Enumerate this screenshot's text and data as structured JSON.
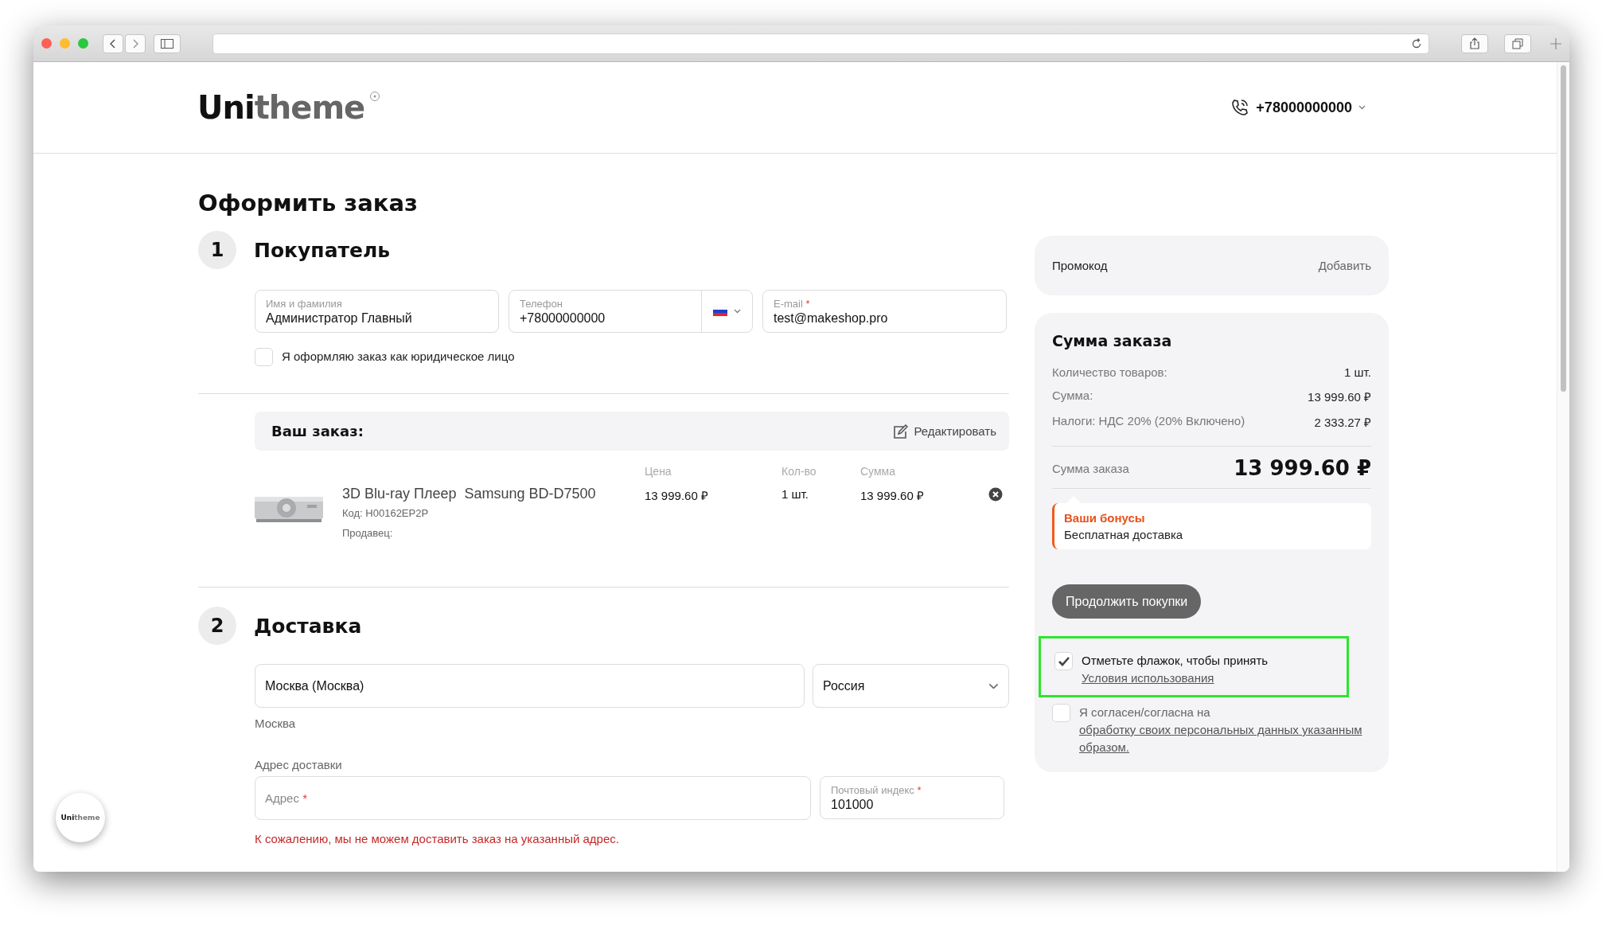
{
  "header": {
    "logo": {
      "primary": "Uni",
      "secondary": "theme"
    },
    "phone": "+78000000000"
  },
  "title": "Оформить заказ",
  "buyer": {
    "step": "1",
    "heading": "Покупатель",
    "fields": [
      {
        "label": "Имя и фамилия",
        "value": "Администратор Главный"
      },
      {
        "label": "Телефон",
        "value": "+78000000000"
      },
      {
        "label": "E-mail",
        "required_mark": "*",
        "value": "test@makeshop.pro"
      }
    ],
    "legal_entity": {
      "label": "Я оформляю заказ как юридическое лицо",
      "checked": false
    }
  },
  "order": {
    "heading": "Ваш заказ:",
    "edit": "Редактировать",
    "columns": [
      "Цена",
      "Кол-во",
      "Сумма"
    ],
    "items": [
      {
        "kind": "picture",
        "name": "3D Blu-ray Плеер  Samsung BD-D7500",
        "code": "Код: H00162EP2P",
        "seller": "Продавец:",
        "price": "13 999.60 ₽",
        "qty": "1 шт.",
        "sum": "13 999.60 ₽"
      }
    ]
  },
  "delivery": {
    "step": "2",
    "heading": "Доставка",
    "city": "Москва (Москва)",
    "country": "Россия",
    "city_note": "Москва",
    "address_heading": "Адрес доставки",
    "address": {
      "placeholder": "Адрес",
      "required_mark": "*"
    },
    "zip": {
      "label": "Почтовый индекс",
      "required_mark": "*",
      "value": "101000"
    },
    "error": "К сожалению, мы не можем доставить заказ на указанный адрес."
  },
  "promo": {
    "label": "Промокод",
    "action": "Добавить"
  },
  "summary": {
    "heading": "Сумма заказа",
    "rows": [
      {
        "label": "Количество товаров:",
        "value": "1 шт."
      },
      {
        "label": "Сумма:",
        "value": "13 999.60 ₽"
      },
      {
        "label": "Налоги: НДС 20% (20% Включено)",
        "value": "2 333.27 ₽"
      }
    ],
    "total_label": "Сумма заказа",
    "total": "13 999.60 ₽",
    "bonus": {
      "title": "Ваши бонусы",
      "text": "Бесплатная доставка"
    },
    "continue": "Продолжить покупки",
    "agreements": [
      {
        "text": "Отметьте флажок, чтобы принять ",
        "link": "Условия использования",
        "checked": true,
        "highlighted": true
      },
      {
        "text": "Я согласен/согласна на ",
        "link": "обработку своих персональных данных указанным образом.",
        "checked": false,
        "highlighted": false
      }
    ]
  },
  "floating_badge": {
    "primary": "Uni",
    "secondary": "theme"
  }
}
